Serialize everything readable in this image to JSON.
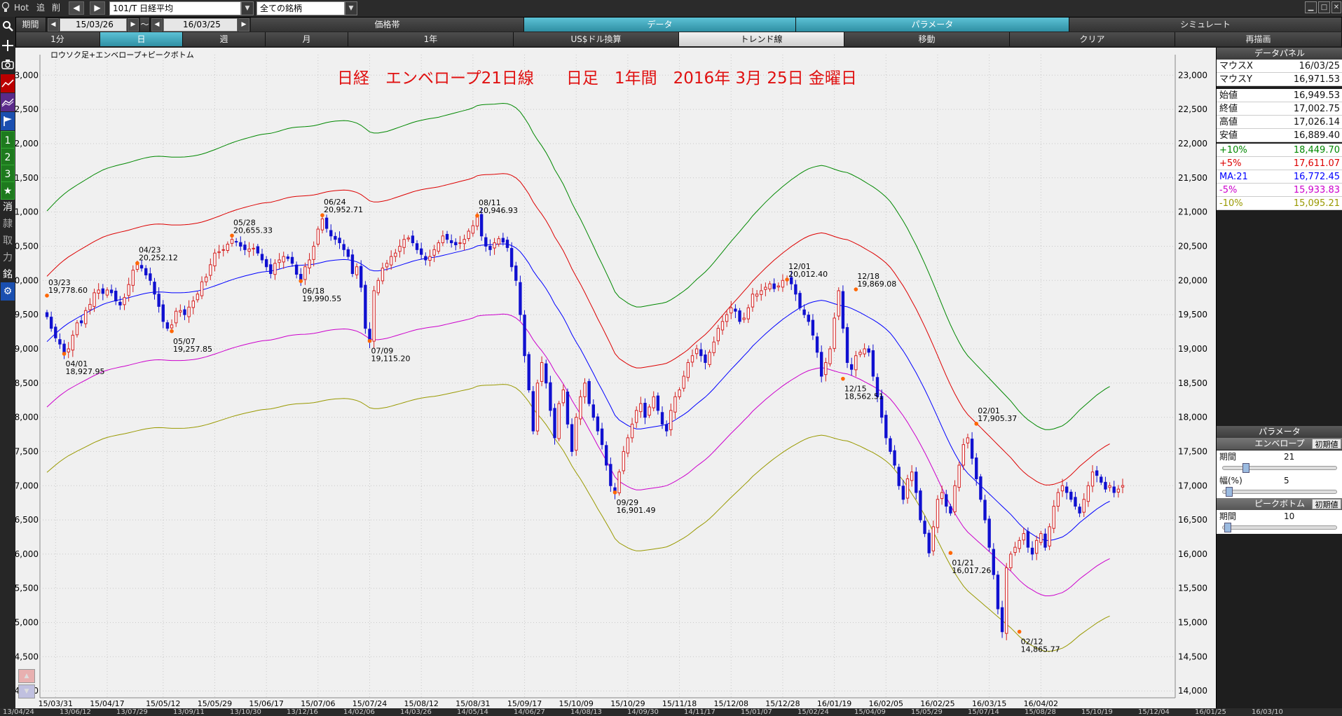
{
  "topbar": {
    "hot_label": "Hot",
    "add_label": "追",
    "delete_label": "削",
    "prev_arrow": "◀",
    "next_arrow": "▶",
    "symbol_input": "101/T 日経平均",
    "universe_select": "全ての銘柄"
  },
  "period_row": {
    "label": "期間",
    "start_date": "15/03/26",
    "tilde": "～",
    "end_date": "16/03/25",
    "tabs": [
      "価格帯",
      "データ",
      "パラメータ",
      "シミュレート"
    ],
    "active_tabs": [
      "データ",
      "パラメータ"
    ]
  },
  "timeframe_row": {
    "items": [
      "1分",
      "日",
      "週",
      "月",
      "1年",
      "US$ドル換算",
      "トレンド線",
      "移動",
      "クリア",
      "再描画"
    ],
    "active": "日"
  },
  "leftbar": {
    "icons": [
      "search-icon",
      "crosshair-icon",
      "camera-icon",
      "line-chart-icon",
      "indicator-icon",
      "flag-icon"
    ],
    "numbers": [
      "1",
      "2",
      "3"
    ],
    "star": "★",
    "kanji": [
      "消",
      "隷",
      "取",
      "力",
      "銘"
    ],
    "gear": "⚙"
  },
  "chart": {
    "indicator_label": "ロウソク足+エンベロープ+ピークボトム",
    "title": "日経　エンベロープ21日線　　日足　1年間　2016年 3月 25日 金曜日",
    "colors": {
      "bg": "#f0f0f0",
      "grid": "#c8c8c8",
      "up": "#d42020",
      "down": "#1010d0",
      "ma": "#0000ff",
      "plus5": "#dd0000",
      "plus10": "#008800",
      "minus5": "#cc00cc",
      "minus10": "#999900",
      "peak": "#ff6600"
    }
  },
  "chart_data": {
    "type": "candlestick",
    "ylim": [
      13900,
      23300
    ],
    "y_ticks": [
      14000,
      14500,
      15000,
      15500,
      16000,
      16500,
      17000,
      17500,
      18000,
      18500,
      19000,
      19500,
      20000,
      20500,
      21000,
      21500,
      22000,
      22500,
      23000
    ],
    "y_tick_labels": [
      "14,000",
      "14,500",
      "15,000",
      "15,500",
      "16,000",
      "16,500",
      "17,000",
      "17,500",
      "18,000",
      "18,500",
      "19,000",
      "19,500",
      "20,000",
      "20,500",
      "21,000",
      "21,500",
      "22,000",
      "22,500",
      "23,000"
    ],
    "x_tick_labels": [
      "15/03/31",
      "15/04/17",
      "15/05/12",
      "15/05/29",
      "15/06/17",
      "15/07/06",
      "15/07/24",
      "15/08/12",
      "15/08/31",
      "15/09/17",
      "15/10/09",
      "15/10/29",
      "15/11/18",
      "15/12/08",
      "15/12/28",
      "16/01/19",
      "16/02/05",
      "16/02/25",
      "16/03/15",
      "16/04/02"
    ],
    "x_tick_index": [
      2,
      14,
      27,
      39,
      51,
      63,
      75,
      87,
      99,
      111,
      123,
      135,
      147,
      159,
      171,
      183,
      195,
      207,
      219,
      231
    ],
    "closes": [
      19470,
      19300,
      19160,
      19070,
      18930,
      19000,
      19200,
      19380,
      19380,
      19560,
      19650,
      19820,
      19860,
      19810,
      19860,
      19820,
      19700,
      19640,
      19750,
      19940,
      20150,
      20250,
      20180,
      20080,
      20000,
      19800,
      19620,
      19400,
      19300,
      19350,
      19550,
      19560,
      19500,
      19610,
      19700,
      19800,
      19980,
      20050,
      20230,
      20400,
      20420,
      20450,
      20530,
      20600,
      20560,
      20500,
      20450,
      20460,
      20470,
      20400,
      20300,
      20200,
      20100,
      20250,
      20300,
      20350,
      20320,
      20250,
      20090,
      19990,
      20200,
      20300,
      20500,
      20750,
      20900,
      20760,
      20650,
      20600,
      20550,
      20450,
      20350,
      20100,
      20200,
      19900,
      19300,
      19100,
      19850,
      20000,
      20180,
      20250,
      20350,
      20400,
      20500,
      20600,
      20620,
      20550,
      20450,
      20380,
      20300,
      20350,
      20450,
      20550,
      20650,
      20600,
      20550,
      20520,
      20550,
      20600,
      20720,
      20800,
      20946,
      20650,
      20500,
      20450,
      20550,
      20610,
      20560,
      20480,
      20200,
      20000,
      19500,
      18900,
      18400,
      17800,
      18500,
      18800,
      18500,
      18100,
      17700,
      18200,
      18400,
      17900,
      17500,
      18000,
      18300,
      18500,
      18200,
      18000,
      17800,
      17600,
      17300,
      17000,
      16901,
      17200,
      17500,
      17700,
      17900,
      18100,
      18200,
      18000,
      18150,
      18300,
      18100,
      17900,
      17800,
      18100,
      18300,
      18400,
      18600,
      18800,
      18900,
      19000,
      18900,
      18800,
      18950,
      19100,
      19300,
      19400,
      19500,
      19600,
      19550,
      19400,
      19450,
      19600,
      19800,
      19800,
      19850,
      19900,
      19950,
      19880,
      19920,
      20000,
      20012,
      19950,
      19800,
      19600,
      19500,
      19400,
      19200,
      18950,
      18600,
      18800,
      19000,
      19450,
      19850,
      19300,
      18800,
      18700,
      18900,
      18950,
      19000,
      18950,
      18600,
      18300,
      18000,
      17700,
      17500,
      17300,
      17000,
      16800,
      17100,
      17200,
      16900,
      16500,
      16300,
      16017,
      16400,
      16800,
      16900,
      16700,
      16600,
      17000,
      17300,
      17600,
      17700,
      17400,
      17100,
      16800,
      16500,
      16100,
      15700,
      15200,
      14865,
      15800,
      16000,
      16100,
      16200,
      16300,
      16100,
      16000,
      16200,
      16300,
      16100,
      16400,
      16700,
      16900,
      17000,
      16900,
      16800,
      16700,
      16600,
      16800,
      17000,
      17200,
      17150,
      17050,
      16950,
      17000,
      16900,
      16950,
      17002
    ],
    "ma21": [
      19105,
      19165,
      19225,
      19280,
      19330,
      19375,
      19412,
      19450,
      19485,
      19520,
      19555,
      19590,
      19620,
      19650,
      19672,
      19690,
      19705,
      19720,
      19733,
      19748,
      19765,
      19782,
      19798,
      19812,
      19823,
      19830,
      19832,
      19830,
      19825,
      19820,
      19820,
      19820,
      19823,
      19828,
      19836,
      19846,
      19860,
      19878,
      19898,
      19920,
      19942,
      19965,
      19988,
      20010,
      20030,
      20048,
      20065,
      20081,
      20096,
      20111,
      20123,
      20130,
      20136,
      20150,
      20166,
      20184,
      20200,
      20211,
      20218,
      20222,
      20225,
      20230,
      20237,
      20250,
      20265,
      20280,
      20290,
      20298,
      20302,
      20306,
      20302,
      20290,
      20272,
      20243,
      20200,
      20155,
      20140,
      20140,
      20150,
      20162,
      20180,
      20200,
      20220,
      20240,
      20260,
      20280,
      20297,
      20310,
      20322,
      20332,
      20340,
      20350,
      20365,
      20380,
      20395,
      20410,
      20425,
      20440,
      20455,
      20475,
      20505,
      20515,
      20520,
      20522,
      20525,
      20530,
      20535,
      20530,
      20510,
      20475,
      20420,
      20340,
      20250,
      20140,
      20050,
      19970,
      19880,
      19775,
      19655,
      19560,
      19460,
      19340,
      19210,
      19100,
      18995,
      18880,
      18760,
      18640,
      18515,
      18400,
      18280,
      18160,
      18030,
      17960,
      17920,
      17880,
      17850,
      17830,
      17830,
      17840,
      17850,
      17860,
      17870,
      17880,
      17895,
      17925,
      17960,
      18000,
      18040,
      18085,
      18140,
      18195,
      18245,
      18295,
      18355,
      18420,
      18490,
      18560,
      18630,
      18700,
      18765,
      18830,
      18900,
      18965,
      19040,
      19100,
      19160,
      19220,
      19275,
      19330,
      19380,
      19430,
      19475,
      19520,
      19560,
      19600,
      19635,
      19665,
      19685,
      19700,
      19710,
      19700,
      19680,
      19660,
      19640,
      19625,
      19615,
      19590,
      19560,
      19530,
      19495,
      19460,
      19425,
      19385,
      19340,
      19290,
      19230,
      19150,
      19060,
      18970,
      18870,
      18760,
      18650,
      18530,
      18405,
      18275,
      18140,
      18000,
      17860,
      17720,
      17590,
      17470,
      17360,
      17260,
      17180,
      17120,
      17060,
      17000,
      16940,
      16880,
      16820,
      16760,
      16700,
      16640,
      16580,
      16510,
      16440,
      16380,
      16330,
      16290,
      16250,
      16220,
      16200,
      16200,
      16210,
      16230,
      16250,
      16290,
      16340,
      16400,
      16460,
      16510,
      16560,
      16610,
      16660,
      16700,
      16740,
      16772
    ],
    "envelope_pct": [
      10,
      5,
      -5,
      -10
    ],
    "annotations": [
      {
        "idx": 0,
        "pos": "high",
        "date": "03/23",
        "value": "19,778.60"
      },
      {
        "idx": 4,
        "pos": "low",
        "date": "04/01",
        "value": "18,927.95"
      },
      {
        "idx": 21,
        "pos": "high",
        "date": "04/23",
        "value": "20,252.12"
      },
      {
        "idx": 29,
        "pos": "low",
        "date": "05/07",
        "value": "19,257.85"
      },
      {
        "idx": 43,
        "pos": "high",
        "date": "05/28",
        "value": "20,655.33"
      },
      {
        "idx": 59,
        "pos": "low",
        "date": "06/18",
        "value": "19,990.55"
      },
      {
        "idx": 64,
        "pos": "high",
        "date": "06/24",
        "value": "20,952.71"
      },
      {
        "idx": 75,
        "pos": "low",
        "date": "07/09",
        "value": "19,115.20"
      },
      {
        "idx": 100,
        "pos": "high",
        "date": "08/11",
        "value": "20,946.93"
      },
      {
        "idx": 132,
        "pos": "low",
        "date": "09/29",
        "value": "16,901.49"
      },
      {
        "idx": 172,
        "pos": "high",
        "date": "12/01",
        "value": "20,012.40"
      },
      {
        "idx": 185,
        "pos": "low",
        "date": "12/15",
        "value": "18,562.51"
      },
      {
        "idx": 188,
        "pos": "high",
        "date": "12/18",
        "value": "19,869.08"
      },
      {
        "idx": 210,
        "pos": "low",
        "date": "01/21",
        "value": "16,017.26"
      },
      {
        "idx": 216,
        "pos": "high",
        "date": "02/01",
        "value": "17,905.37"
      },
      {
        "idx": 226,
        "pos": "low",
        "date": "02/12",
        "value": "14,865.77"
      }
    ]
  },
  "data_panel": {
    "title": "データパネル",
    "rows": [
      {
        "k": "マウスX",
        "v": "16/03/25",
        "color": "#111111"
      },
      {
        "k": "マウスY",
        "v": "16,971.53",
        "color": "#111111"
      },
      {
        "k": "始値",
        "v": "16,949.53",
        "color": "#111111"
      },
      {
        "k": "終値",
        "v": "17,002.75",
        "color": "#111111"
      },
      {
        "k": "高値",
        "v": "17,026.14",
        "color": "#111111"
      },
      {
        "k": "安値",
        "v": "16,889.40",
        "color": "#111111"
      },
      {
        "k": "+10%",
        "v": "18,449.70",
        "color": "#008800"
      },
      {
        "k": "+5%",
        "v": "17,611.07",
        "color": "#dd0000"
      },
      {
        "k": "MA:21",
        "v": "16,772.45",
        "color": "#0000ff"
      },
      {
        "k": "-5%",
        "v": "15,933.83",
        "color": "#cc00cc"
      },
      {
        "k": "-10%",
        "v": "15,095.21",
        "color": "#999900"
      }
    ]
  },
  "param_panel": {
    "title": "パラメータ",
    "envelope_title": "エンベロープ",
    "reset_label": "初期値",
    "period_label": "期間",
    "period_value": "21",
    "width_label": "幅(%)",
    "width_value": "5",
    "peak_title": "ピークボトム",
    "peak_period_label": "期間",
    "peak_period_value": "10"
  },
  "bottom_dates": [
    "13/04/24",
    "13/06/12",
    "13/07/29",
    "13/09/11",
    "13/10/30",
    "13/12/16",
    "14/02/06",
    "14/03/26",
    "14/05/14",
    "14/06/27",
    "14/08/13",
    "14/09/30",
    "14/11/17",
    "15/01/07",
    "15/02/24",
    "15/04/09",
    "15/05/29",
    "15/07/14",
    "15/08/28",
    "15/10/19",
    "15/12/04",
    "16/01/25",
    "16/03/10"
  ]
}
